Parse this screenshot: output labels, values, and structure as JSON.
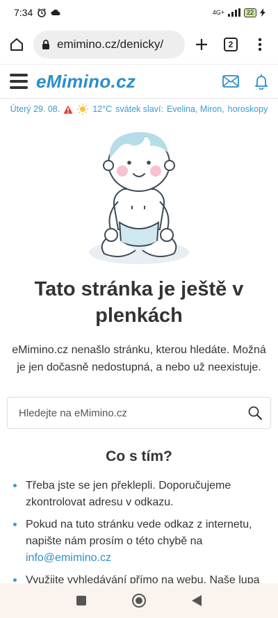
{
  "status_bar": {
    "time": "7:34",
    "network": "4G+",
    "battery": "22"
  },
  "browser": {
    "url": "emimino.cz/denicky/",
    "tab_count": "2"
  },
  "header": {
    "logo": "eMimino.cz"
  },
  "info_line": {
    "date": "Úterý 29. 08.",
    "temperature": "12°C",
    "nameday_prefix": "svátek slaví:",
    "names": "Evelina, Miron,",
    "horoscopes": "horoskopy"
  },
  "error": {
    "title": "Tato stránka je ještě v plenkách",
    "description": "eMimino.cz nenašlo stránku, kterou hledáte. Možná je jen dočasně nedostupná, a nebo už neexistuje."
  },
  "search": {
    "placeholder": "Hledejte na eMimino.cz"
  },
  "help": {
    "title": "Co s tím?",
    "tip1": "Třeba jste se jen překlepli. Doporučujeme zkontrolovat adresu v odkazu.",
    "tip2": "Pokud na tuto stránku vede odkaz z internetu, napište nám prosím o této chybě na",
    "tip2_email": "info@emimino.cz",
    "tip3": "Využijte vyhledávání přímo na webu. Naše lupa"
  },
  "colors": {
    "accent": "#2a8fc7",
    "warning": "#e53935",
    "nav_bg": "#fbf4ee"
  }
}
